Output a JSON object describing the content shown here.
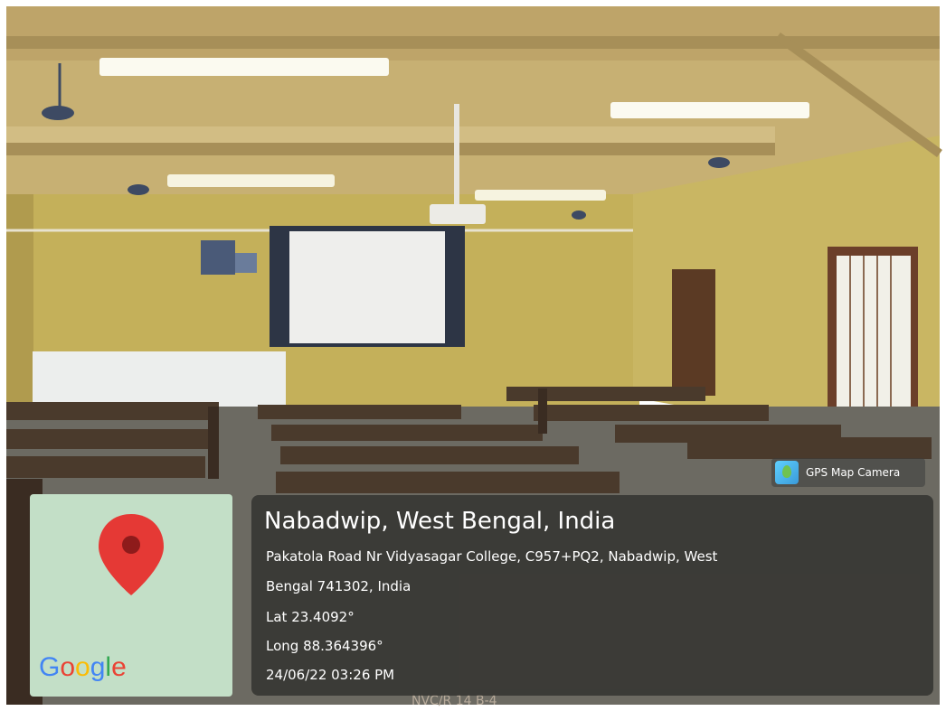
{
  "badge": {
    "label": "GPS Map Camera",
    "icon": "gps-map-camera-app-icon"
  },
  "location": {
    "title": "Nabadwip, West Bengal, India",
    "address_line1": "Pakatola Road Nr Vidyasagar College, C957+PQ2, Nabadwip, West",
    "address_line2": "Bengal 741302, India",
    "lat": "Lat 23.4092°",
    "long": "Long 88.364396°",
    "datetime": "24/06/22 03:26 PM"
  },
  "map": {
    "logo_text": "Google",
    "pin_color": "#e53935"
  },
  "scene": {
    "bench_marking": "NVC/R 14 B-4"
  }
}
